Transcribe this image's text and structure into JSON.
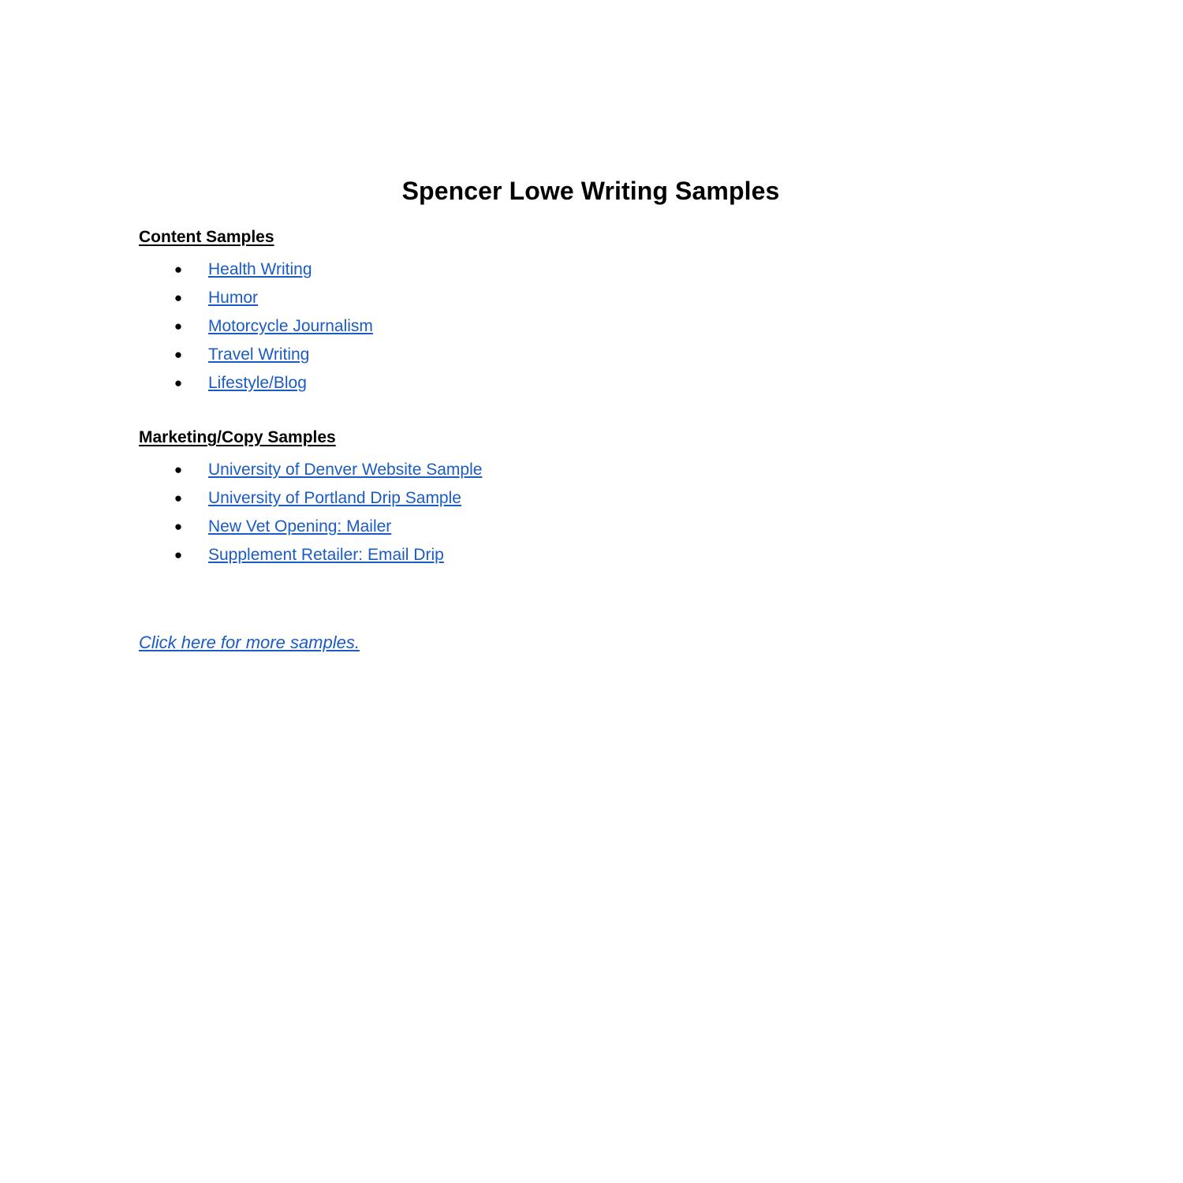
{
  "document": {
    "title": "Spencer Lowe Writing Samples",
    "bullet_glyph": "●",
    "link_color": "#1a5bc4",
    "text_color": "#000000",
    "background_color": "#ffffff"
  },
  "sections": [
    {
      "heading": "Content Samples",
      "items": [
        {
          "label": "Health Writing"
        },
        {
          "label": "Humor"
        },
        {
          "label": "Motorcycle Journalism"
        },
        {
          "label": "Travel Writing"
        },
        {
          "label": "Lifestyle/Blog"
        }
      ]
    },
    {
      "heading": "Marketing/Copy Samples",
      "items": [
        {
          "label": "University of Denver Website Sample"
        },
        {
          "label": "University of Portland Drip Sample"
        },
        {
          "label": "New Vet Opening: Mailer"
        },
        {
          "label": "Supplement Retailer: Email Drip"
        }
      ]
    }
  ],
  "footer": {
    "link_label": "Click here for more samples."
  }
}
